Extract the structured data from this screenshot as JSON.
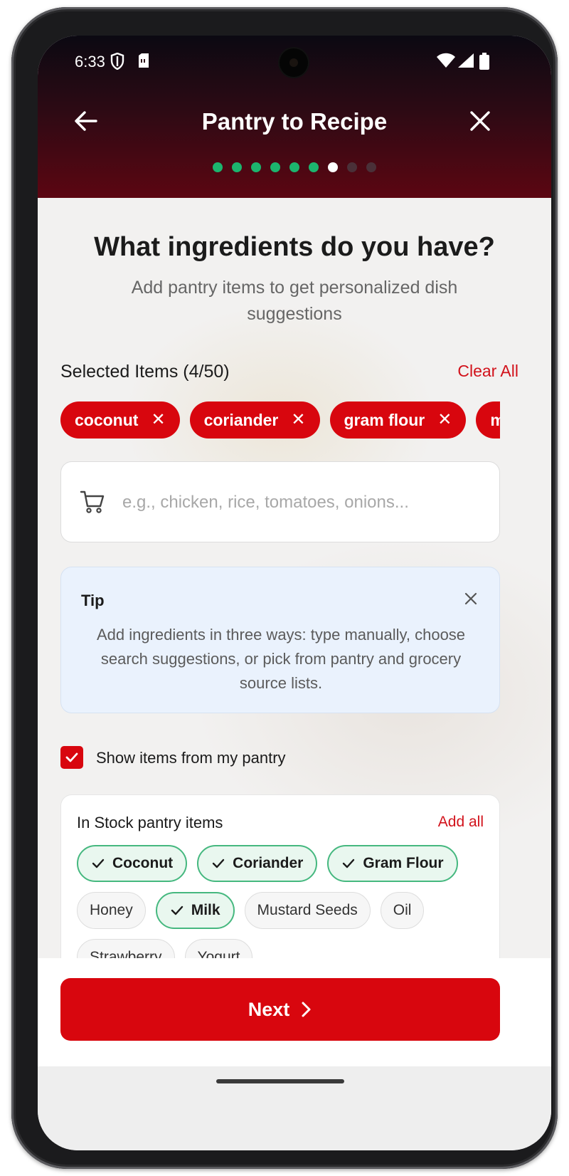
{
  "status_bar": {
    "time": "6:33"
  },
  "header": {
    "title": "Pantry to Recipe",
    "progress": {
      "total_steps": 9,
      "completed_steps": 6,
      "current_step": 7
    }
  },
  "main": {
    "heading": "What ingredients do you have?",
    "subheading": "Add pantry items to get personalized dish suggestions",
    "selected": {
      "label": "Selected Items (4/50)",
      "clear_label": "Clear All",
      "items": [
        "coconut",
        "coriander",
        "gram flour",
        "milk"
      ]
    },
    "search": {
      "placeholder": "e.g., chicken, rice, tomatoes, onions...",
      "value": ""
    },
    "tip": {
      "title": "Tip",
      "body": "Add ingredients in three ways: type manually, choose search suggestions, or pick from pantry and grocery source lists."
    },
    "pantry_toggle": {
      "label": "Show items from my pantry",
      "checked": true
    },
    "in_stock": {
      "title": "In Stock pantry items",
      "add_all_label": "Add all",
      "items": [
        {
          "label": "Coconut",
          "selected": true
        },
        {
          "label": "Coriander",
          "selected": true
        },
        {
          "label": "Gram Flour",
          "selected": true
        },
        {
          "label": "Honey",
          "selected": false
        },
        {
          "label": "Milk",
          "selected": true
        },
        {
          "label": "Mustard Seeds",
          "selected": false
        },
        {
          "label": "Oil",
          "selected": false
        },
        {
          "label": "Strawberry",
          "selected": false
        },
        {
          "label": "Yogurt",
          "selected": false
        }
      ]
    }
  },
  "footer": {
    "next_label": "Next"
  },
  "colors": {
    "brand_red": "#d8060e",
    "progress_done": "#1cb56e",
    "progress_current": "#ffffff",
    "selected_chip_border": "#45b87f",
    "tip_background": "#eaf2fd"
  },
  "icons": [
    "back-arrow-icon",
    "close-icon",
    "cart-icon",
    "check-icon",
    "chevron-right-icon",
    "shield-icon",
    "sim-card-icon",
    "wifi-icon",
    "signal-icon",
    "battery-icon"
  ]
}
